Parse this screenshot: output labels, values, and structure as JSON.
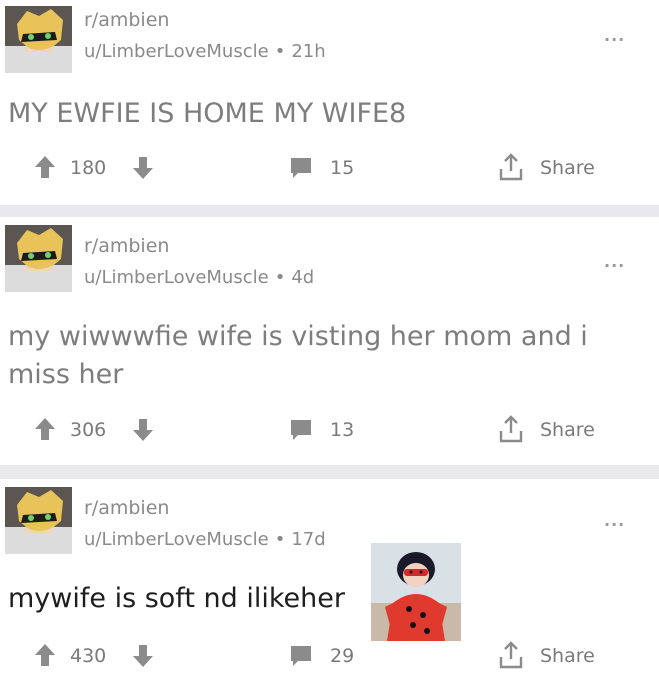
{
  "posts": [
    {
      "subreddit": "r/ambien",
      "author": "u/LimberLoveMuscle",
      "age": "21h",
      "title": "MY EWFIE IS HOME MY WIFE8",
      "score": "180",
      "comments": "15",
      "share_label": "Share",
      "more_label": "···"
    },
    {
      "subreddit": "r/ambien",
      "author": "u/LimberLoveMuscle",
      "age": "4d",
      "title": "my wiwwwfie wife is visting her mom and i miss her",
      "score": "306",
      "comments": "13",
      "share_label": "Share",
      "more_label": "···"
    },
    {
      "subreddit": "r/ambien",
      "author": "u/LimberLoveMuscle",
      "age": "17d",
      "title": "mywife is soft nd ilikeher",
      "score": "430",
      "comments": "29",
      "share_label": "Share",
      "more_label": "···"
    }
  ],
  "separator_dot": "•",
  "colors": {
    "background": "#ffffff",
    "separator": "#e9e9ed",
    "meta_text": "#8a8a8a",
    "icon": "#8b8b8b",
    "title_dark": "#1e1e1e"
  },
  "icons": {
    "avatar": "cat-noir-avatar",
    "upvote": "arrow-up-icon",
    "downvote": "arrow-down-icon",
    "comment": "comment-icon",
    "share": "share-icon",
    "more": "more-icon",
    "sticker": "ladybug-sticker"
  }
}
